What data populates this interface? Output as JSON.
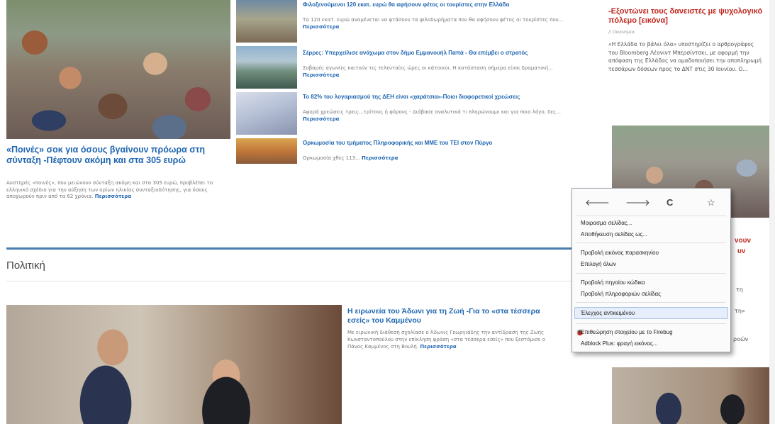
{
  "top_articles": {
    "main": {
      "title": "«Ποινές» σοκ για όσους βγαίνουν πρόωρα στη σύνταξη -Πέφτουν ακόμη και στα 305 ευρώ",
      "summary": "Αυστηρές «ποινές», που μειώνουν σύνταξη ακόμη και στα 305 ευρώ, προβλέπει το ελληνικό σχέδιο για την αύξηση των ορίων ηλικίας συνταξιοδότησης, για όσους αποχωρούν πριν από τα 62 χρόνια.",
      "more": "Περισσότερα"
    },
    "list": [
      {
        "title": "Φιλοξενούμενοι 120 εκατ. ευρώ θα αφήσουν φέτος οι τουρίστες στην Ελλάδα",
        "summary": "Τα 120 εκατ. ευρώ αναμένεται να φτάσουν τα φιλοδωρήματα που θα αφήσουν φέτος οι τουρίστες που...",
        "more": "Περισσότερα"
      },
      {
        "title": "Σέρρες: Υπερχείλισε ανάχωμα στον δήμο Εμμανουήλ Παπά - Θα επέμβει ο στρατός",
        "summary": "Σοβαρές αγωνίες καιτούν τις τελευταίες ώρες οι κάτοικοι. Η κατάσταση σήμερα είναι δραματική...",
        "more": "Περισσότερα"
      },
      {
        "title": "Το 82% του λογαριασμού της ΔΕΗ είναι «χαράτσια»-Ποιοι διαφορετικοί χρεώσεις",
        "summary": "Αφορά χρεώσεις τρεις...τρίτους ή φόρους - Διάβασε αναλυτικά τι πληρώνουμε και για ποιο λόγο, δες...",
        "more": "Περισσότερα"
      },
      {
        "title": "Ορκωμοσία του τμήματος Πληροφορικής και ΜΜΕ του ΤΕΙ στον Πύργο",
        "summary": "Ορκωμοσία χθες 113...",
        "more": "Περισσότερα"
      }
    ]
  },
  "section": {
    "title": "Πολιτική"
  },
  "politics_article": {
    "title": "Η ειρωνεία του Άδωνι για τη Ζωή -Για το «στα τέσσερα εσείς» του Καμμένου",
    "summary": "Με ειρωνική διάθεση σχολίασε ο Άδωνις Γεωργιάδης την αντίδραση της Ζωής Κωνσταντοπούλου στην επίκληση φράση «στα τέσσερα εσείς» που ξεστόμισε ο Πάνος Καμμένος στη Βουλή.",
    "more": "Περισσότερα"
  },
  "sidebar": {
    "headline": "-Εξοντώνει τους δανειστές με ψυχολογικό πόλεμο [εικόνα]",
    "date": "// Οικονομία",
    "text": "«Η Ελλάδα το βάλει όλα» υποστηρίζει ο αρθρογράφος του Bloomberg Λέονιντ Μπερσίντσκι, με αφορμή την απόφαση της Ελλάδας να ομαδοποιήσει την αποπληρωμή τεσσάρων δόσεων προς το ΔΝΤ στις 30 Ιουνίου. Ο...",
    "peek_red": [
      "νουν",
      "υν"
    ],
    "peek_text": [
      "τη",
      "τη»",
      "ροών"
    ]
  },
  "context_menu": {
    "nav": {
      "back": "🡐",
      "forward": "🡒",
      "reload": "C",
      "bookmark": "☆"
    },
    "groups": [
      [
        "Μοιρασμα σελίδας...",
        "Αποθήκευση σελίδας ως..."
      ],
      [
        "Προβολή εικόνας παρασκηνίου",
        "Επιλογή όλων"
      ],
      [
        "Προβολή πηγαίου κώδικα",
        "Προβολή πληροφοριών σελίδας"
      ],
      [
        "Έλεγχος αντικειμένου"
      ],
      [
        "Επιθεώρηση στοιχείου με το Firebug",
        "Adblock Plus: φραγή εικόνας..."
      ]
    ]
  },
  "colors": {
    "link": "#1f66b0",
    "accent_red": "#c0281f",
    "section_bar": "#4a7cae"
  }
}
